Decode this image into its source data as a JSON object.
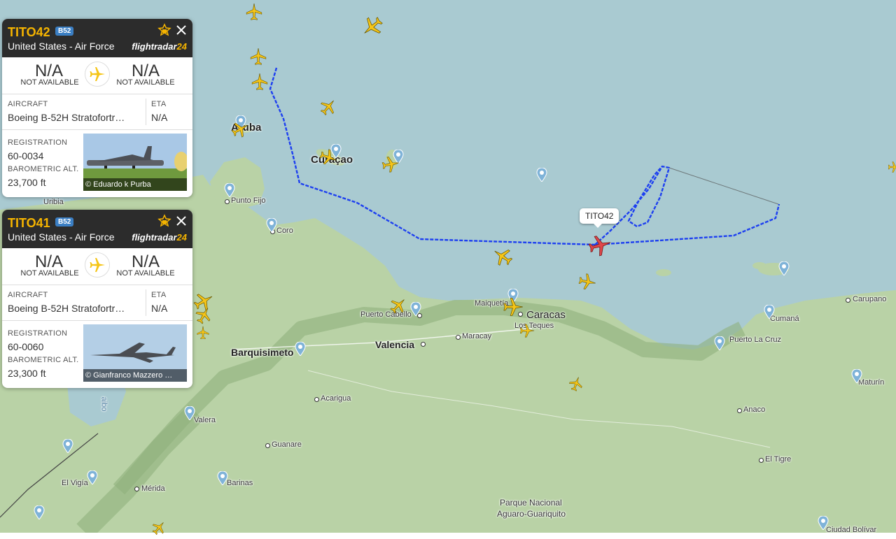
{
  "app": {
    "brand": "flightradar",
    "brand_num": "24"
  },
  "colors": {
    "sea": "#a8c9cf",
    "land": "#b7d3a4",
    "track": "#1d3ff0",
    "selected_plane": "#e0464a",
    "plane": "#f5c518",
    "accent": "#f5b400"
  },
  "flights": [
    {
      "callsign": "TITO42",
      "type_badge": "B52",
      "airline": "United States - Air Force",
      "origin": "N/A",
      "origin_sub": "NOT AVAILABLE",
      "destination": "N/A",
      "destination_sub": "NOT AVAILABLE",
      "aircraft_label": "AIRCRAFT",
      "aircraft": "Boeing B-52H Stratofortr…",
      "eta_label": "ETA",
      "eta": "N/A",
      "registration_label": "REGISTRATION",
      "registration": "60-0034",
      "altitude_label": "BAROMETRIC ALT.",
      "altitude": "23,700 ft",
      "photo_credit": "© Eduardo k Purba"
    },
    {
      "callsign": "TITO41",
      "type_badge": "B52",
      "airline": "United States - Air Force",
      "origin": "N/A",
      "origin_sub": "NOT AVAILABLE",
      "destination": "N/A",
      "destination_sub": "NOT AVAILABLE",
      "aircraft_label": "AIRCRAFT",
      "aircraft": "Boeing B-52H Stratofortr…",
      "eta_label": "ETA",
      "eta": "N/A",
      "registration_label": "REGISTRATION",
      "registration": "60-0060",
      "altitude_label": "BAROMETRIC ALT.",
      "altitude": "23,300 ft",
      "photo_credit": "© Gianfranco Mazzero …"
    }
  ],
  "map": {
    "selected_callout": "TITO42",
    "places": {
      "aruba": "Aruba",
      "curacao": "Curaçao",
      "punto_fijo": "Punto Fijo",
      "coro": "Coro",
      "uribia": "Uribia",
      "puerto_cabello": "Puerto Cabello",
      "maiquetia": "Maiquetía",
      "caracas": "Caracas",
      "los_teques": "Los Teques",
      "valencia": "Valencia",
      "maracay": "Maracay",
      "barquisimeto": "Barquisimeto",
      "acarigua": "Acarigua",
      "guanare": "Guanare",
      "valera": "Valera",
      "barinas": "Barinas",
      "el_vigia": "El Vigía",
      "merida": "Mérida",
      "cumana": "Cumaná",
      "carupano": "Carupano",
      "puerto_la_cruz": "Puerto La Cruz",
      "maturin": "Maturín",
      "anaco": "Anaco",
      "el_tigre": "El Tigre",
      "parque_line1": "Parque Nacional",
      "parque_line2": "Aguaro-Guariquito",
      "ciudad_bolivar": "Ciudad Bolívar",
      "lago": "aibo"
    }
  }
}
